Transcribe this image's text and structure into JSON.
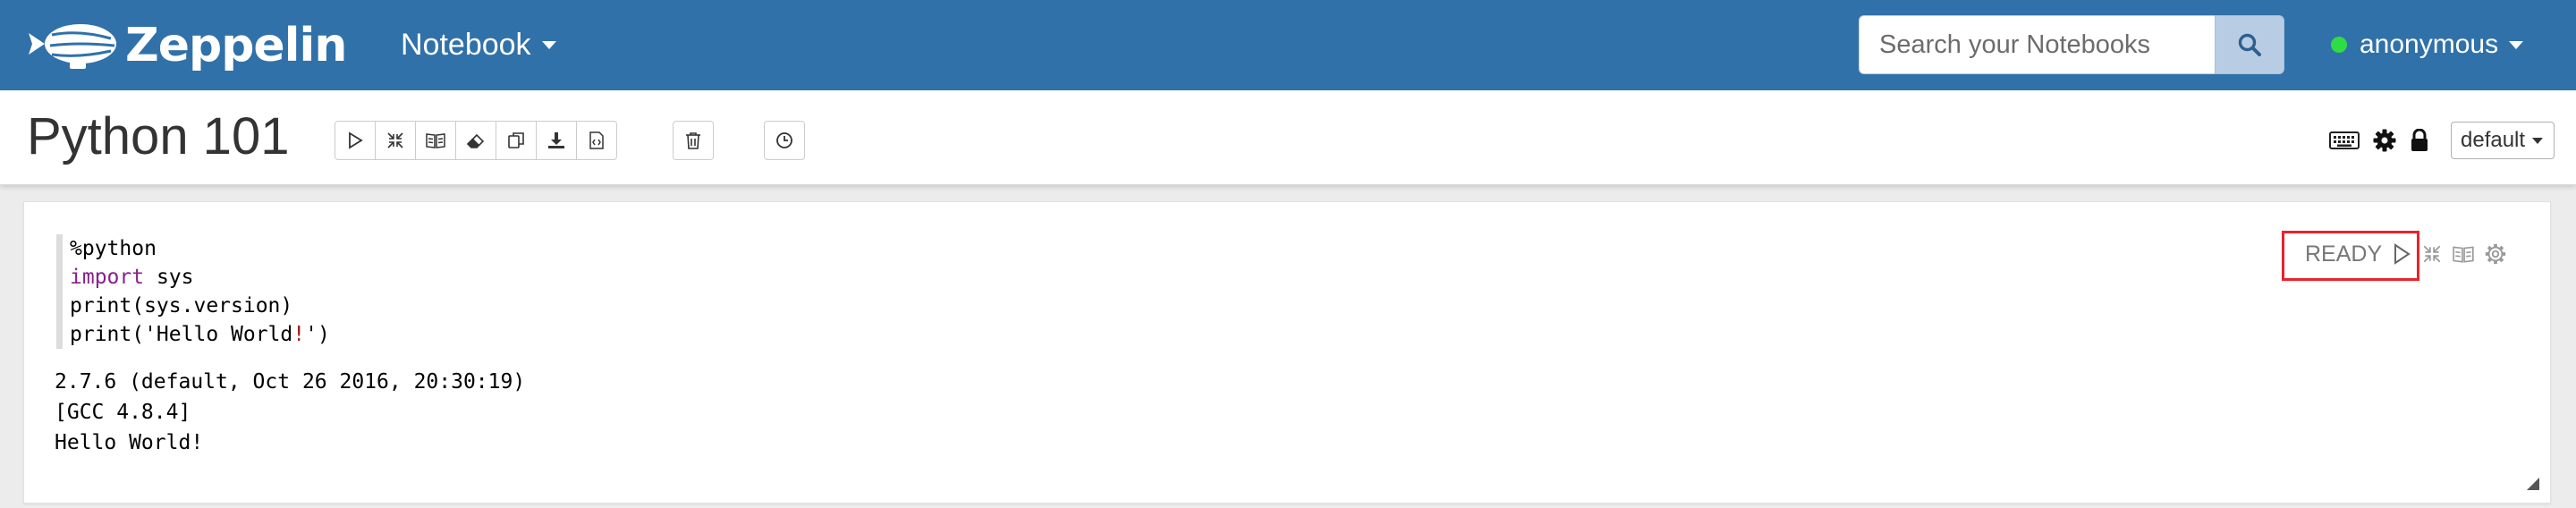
{
  "navbar": {
    "brand": "Zeppelin",
    "notebook_menu": "Notebook",
    "search_placeholder": "Search your Notebooks",
    "user": "anonymous"
  },
  "notebook": {
    "title": "Python 101",
    "toolbar_icons": [
      "run-all-icon",
      "hide-code-icon",
      "hide-output-icon",
      "clear-output-icon",
      "clone-icon",
      "export-icon",
      "version-control-icon",
      "trash-icon",
      "scheduler-icon"
    ],
    "interpreter_selected": "default"
  },
  "paragraph": {
    "code_lines": [
      "%python",
      "import",
      " sys",
      "print(sys.version)",
      "print('Hello World",
      "!",
      "')"
    ],
    "output_lines": [
      "2.7.6 (default, Oct 26 2016, 20:30:19)",
      "[GCC 4.8.4]",
      "Hello World!"
    ],
    "status": "READY"
  },
  "colors": {
    "navbar_bg": "#3071a9",
    "highlight": "#e8232b",
    "status_dot": "#2fdc44",
    "keyword": "#8a1f8a"
  }
}
